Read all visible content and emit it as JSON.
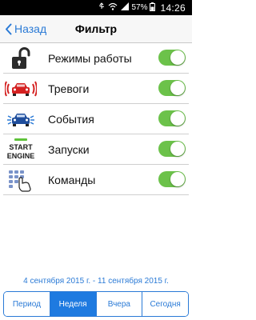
{
  "status_bar": {
    "battery_percent": "57%",
    "time": "14:26"
  },
  "nav": {
    "back_label": "Назад",
    "title": "Фильтр"
  },
  "filters": [
    {
      "label": "Режимы работы",
      "icon": "lock-open-icon",
      "enabled": true
    },
    {
      "label": "Тревоги",
      "icon": "car-alarm-icon",
      "enabled": true
    },
    {
      "label": "События",
      "icon": "car-event-icon",
      "enabled": true
    },
    {
      "label": "Запуски",
      "icon": "start-engine-icon",
      "enabled": true,
      "icon_text": [
        "START",
        "ENGINE"
      ]
    },
    {
      "label": "Команды",
      "icon": "keypad-hand-icon",
      "enabled": true
    }
  ],
  "date_range": "4 сентября 2015 г. - 11 сентября 2015 г.",
  "segments": [
    {
      "label": "Период",
      "active": false
    },
    {
      "label": "Неделя",
      "active": true
    },
    {
      "label": "Вчера",
      "active": false
    },
    {
      "label": "Сегодня",
      "active": false
    }
  ],
  "colors": {
    "accent": "#2a7ad6",
    "toggle_on": "#6cc24a",
    "segment_active": "#1e7ae0"
  }
}
